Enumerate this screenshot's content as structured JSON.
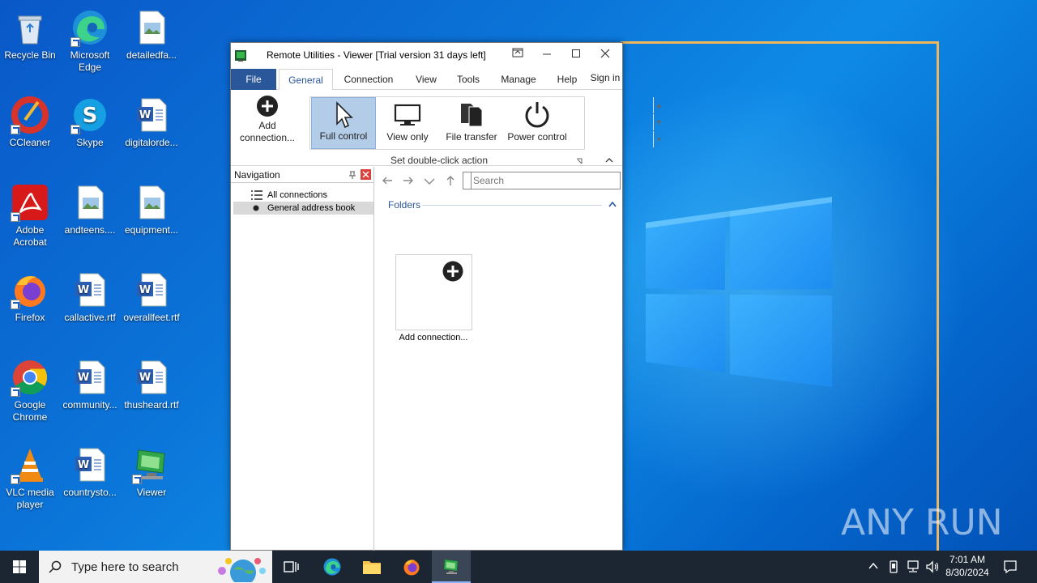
{
  "desktop": {
    "icons": [
      {
        "label": "Recycle Bin"
      },
      {
        "label": "Microsoft Edge"
      },
      {
        "label": "detailedfa..."
      },
      {
        "label": "CCleaner"
      },
      {
        "label": "Skype"
      },
      {
        "label": "digitalorde..."
      },
      {
        "label": "Adobe Acrobat"
      },
      {
        "label": "andteens...."
      },
      {
        "label": "equipment..."
      },
      {
        "label": "Firefox"
      },
      {
        "label": "callactive.rtf"
      },
      {
        "label": "overallfeet.rtf"
      },
      {
        "label": "Google Chrome"
      },
      {
        "label": "community..."
      },
      {
        "label": "thusheard.rtf"
      },
      {
        "label": "VLC media player"
      },
      {
        "label": "countrysto..."
      },
      {
        "label": "Viewer"
      }
    ]
  },
  "window": {
    "title": "Remote Utilities - Viewer [Trial version 31 days left]",
    "tabs": {
      "file": "File",
      "general": "General",
      "connection": "Connection",
      "view": "View",
      "tools": "Tools",
      "manage": "Manage",
      "help": "Help",
      "signin": "Sign in"
    },
    "ribbon": {
      "add_connection": "Add connection...",
      "modes": [
        {
          "label": "Full control"
        },
        {
          "label": "View only"
        },
        {
          "label": "File transfer"
        },
        {
          "label": "Power control"
        }
      ],
      "group_label": "Set double-click action"
    },
    "nav": {
      "title": "Navigation",
      "items": [
        {
          "label": "All connections"
        },
        {
          "label": "General address book"
        }
      ]
    },
    "main": {
      "search_placeholder": "Search",
      "folders_label": "Folders",
      "add_connection_tile": "Add connection..."
    }
  },
  "taskbar": {
    "search_placeholder": "Type here to search",
    "time": "7:01 AM",
    "date": "8/30/2024"
  },
  "watermark": "ANY RUN"
}
